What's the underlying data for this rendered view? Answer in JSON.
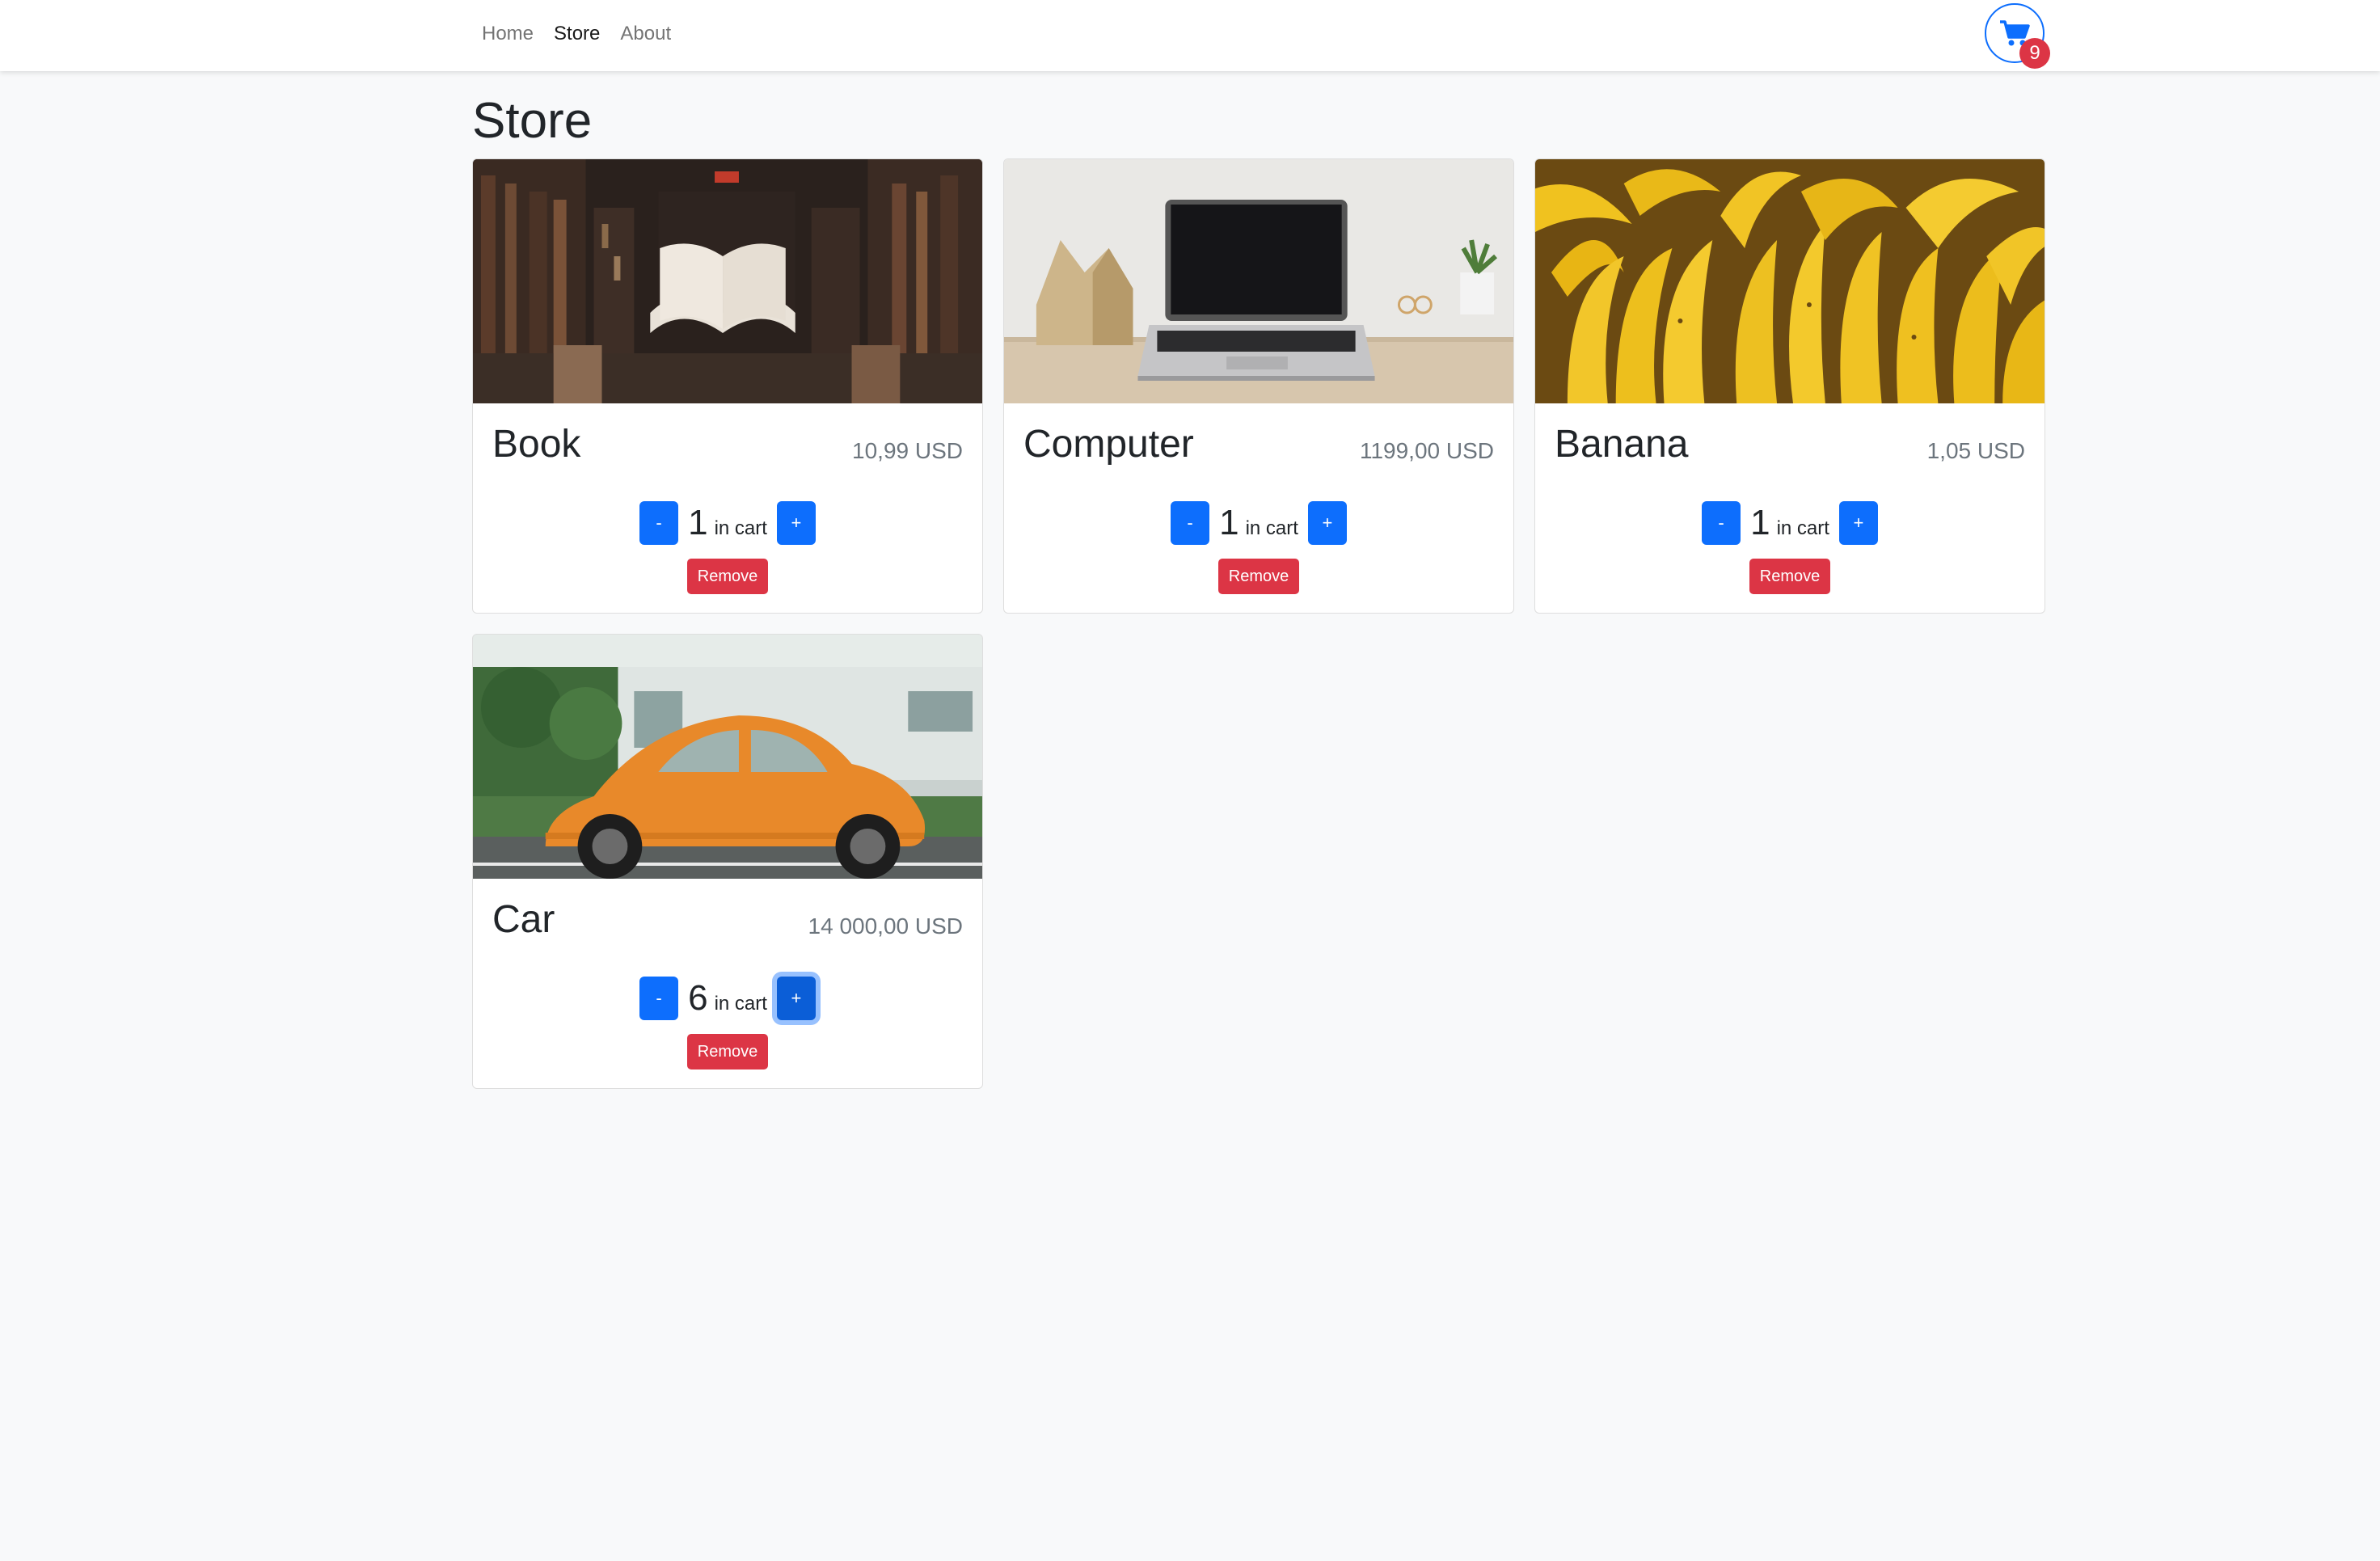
{
  "nav": {
    "links": [
      "Home",
      "Store",
      "About"
    ],
    "active": "Store",
    "cart_count": "9"
  },
  "page": {
    "title": "Store"
  },
  "products": [
    {
      "name": "Book",
      "price": "10,99 USD",
      "quantity": "1",
      "qty_label": "in cart",
      "minus": "-",
      "plus": "+",
      "remove": "Remove"
    },
    {
      "name": "Computer",
      "price": "1199,00 USD",
      "quantity": "1",
      "qty_label": "in cart",
      "minus": "-",
      "plus": "+",
      "remove": "Remove"
    },
    {
      "name": "Banana",
      "price": "1,05 USD",
      "quantity": "1",
      "qty_label": "in cart",
      "minus": "-",
      "plus": "+",
      "remove": "Remove"
    },
    {
      "name": "Car",
      "price": "14 000,00 USD",
      "quantity": "6",
      "qty_label": "in cart",
      "minus": "-",
      "plus": "+",
      "remove": "Remove"
    }
  ],
  "colors": {
    "primary": "#0d6efd",
    "danger": "#dc3545",
    "background": "#f8f9fa"
  },
  "icons": {
    "cart": "shopping-cart-icon"
  }
}
